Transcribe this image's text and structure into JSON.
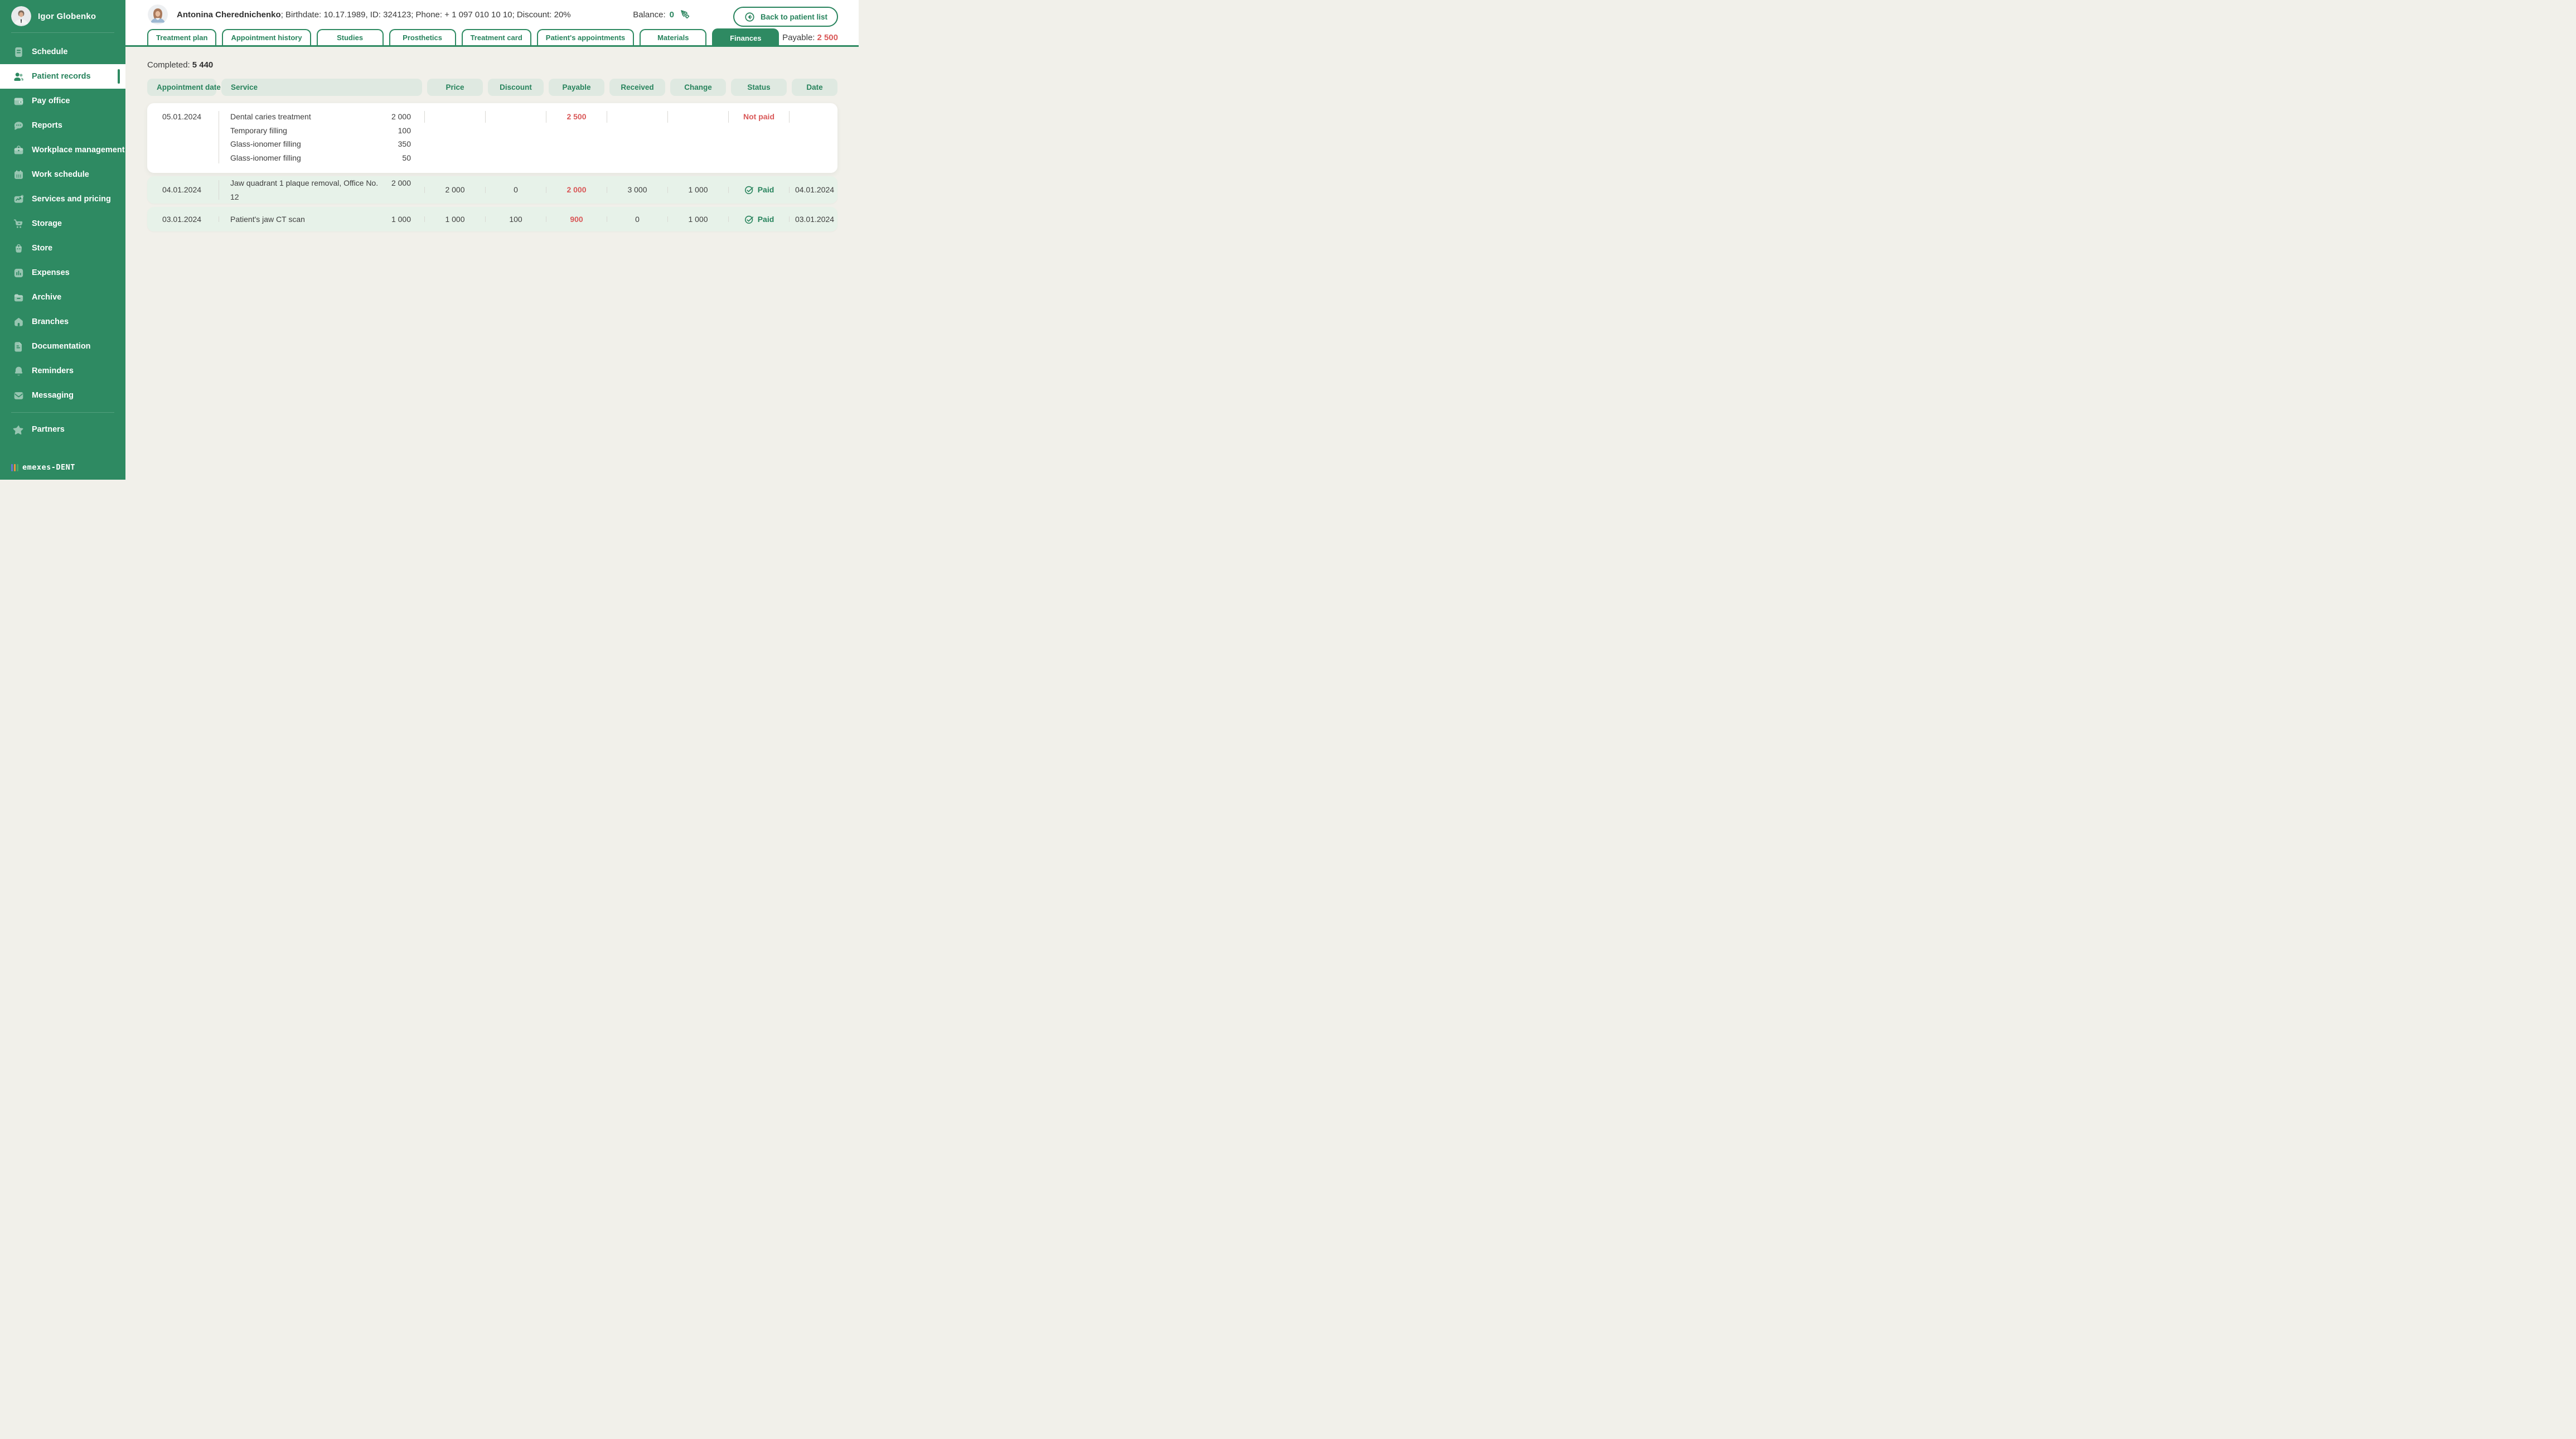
{
  "colors": {
    "accent_green": "#2E8A62",
    "green_text": "#27835C",
    "red": "#D95858",
    "sidebar_bg": "#2E8A62",
    "content_bg": "#F1F0EA",
    "row_green": "#E7F2E9",
    "pill_bg": "#DFE9E1",
    "logo_bars": [
      "#6A74D8",
      "#F0923F",
      "#49A96B"
    ]
  },
  "sidebar": {
    "user_name": "Igor Globenko",
    "items": [
      {
        "label": "Schedule",
        "icon": "schedule-icon"
      },
      {
        "label": "Patient records",
        "icon": "patients-icon",
        "active": true
      },
      {
        "label": "Pay office",
        "icon": "wallet-icon"
      },
      {
        "label": "Reports",
        "icon": "chat-icon"
      },
      {
        "label": "Workplace management",
        "icon": "briefcase-icon"
      },
      {
        "label": "Work schedule",
        "icon": "calendar-icon"
      },
      {
        "label": "Services and pricing",
        "icon": "chart-icon"
      },
      {
        "label": "Storage",
        "icon": "cart-icon"
      },
      {
        "label": "Store",
        "icon": "bag-icon"
      },
      {
        "label": "Expenses",
        "icon": "bar-chart-icon"
      },
      {
        "label": "Archive",
        "icon": "folder-icon"
      },
      {
        "label": "Branches",
        "icon": "home-icon"
      },
      {
        "label": "Documentation",
        "icon": "document-icon"
      },
      {
        "label": "Reminders",
        "icon": "bell-icon"
      },
      {
        "label": "Messaging",
        "icon": "mail-icon"
      },
      {
        "label": "Partners",
        "icon": "star-icon",
        "divider_before": true
      }
    ],
    "logo_text": "emexes-DENT"
  },
  "header": {
    "patient_name": "Antonina Cherednichenko",
    "patient_details": "; Birthdate: 10.17.1989, ID: 324123; Phone: + 1 097 010 10 10; Discount: 20%",
    "balance_label": "Balance:",
    "balance_value": "0",
    "back_button_label": "Back to patient list"
  },
  "tabs": [
    {
      "label": "Treatment plan"
    },
    {
      "label": "Appointment history"
    },
    {
      "label": "Studies"
    },
    {
      "label": "Prosthetics"
    },
    {
      "label": "Treatment card"
    },
    {
      "label": "Patient's appointments"
    },
    {
      "label": "Materials"
    },
    {
      "label": "Finances",
      "active": true
    }
  ],
  "finance_summary": {
    "payable_label": "Payable:",
    "payable_value": "2 500",
    "completed_label": "Completed:",
    "completed_value": "5 440"
  },
  "table": {
    "columns": [
      "Appointment date",
      "Service",
      "Price",
      "Discount",
      "Payable",
      "Received",
      "Change",
      "Status",
      "Date"
    ],
    "rows": [
      {
        "appointment_date": "05.01.2024",
        "services": [
          {
            "name": "Dental caries treatment",
            "amount": "2 000"
          },
          {
            "name": "Temporary filling",
            "amount": "100"
          },
          {
            "name": "Glass-ionomer filling",
            "amount": "350"
          },
          {
            "name": "Glass-ionomer filling",
            "amount": "50"
          }
        ],
        "price": "",
        "discount": "",
        "payable": "2 500",
        "received": "",
        "change": "",
        "status": "Not paid",
        "status_type": "not_paid",
        "date": ""
      },
      {
        "appointment_date": "04.01.2024",
        "services": [
          {
            "name": "Jaw quadrant 1 plaque removal, Office No. 12",
            "amount": "2 000"
          }
        ],
        "price": "2 000",
        "discount": "0",
        "payable": "2 000",
        "received": "3 000",
        "change": "1 000",
        "status": "Paid",
        "status_type": "paid",
        "date": "04.01.2024"
      },
      {
        "appointment_date": "03.01.2024",
        "services": [
          {
            "name": "Patient's jaw CT scan",
            "amount": "1 000"
          }
        ],
        "price": "1 000",
        "discount": "100",
        "payable": "900",
        "received": "0",
        "change": "1 000",
        "status": "Paid",
        "status_type": "paid",
        "date": "03.01.2024"
      }
    ]
  }
}
